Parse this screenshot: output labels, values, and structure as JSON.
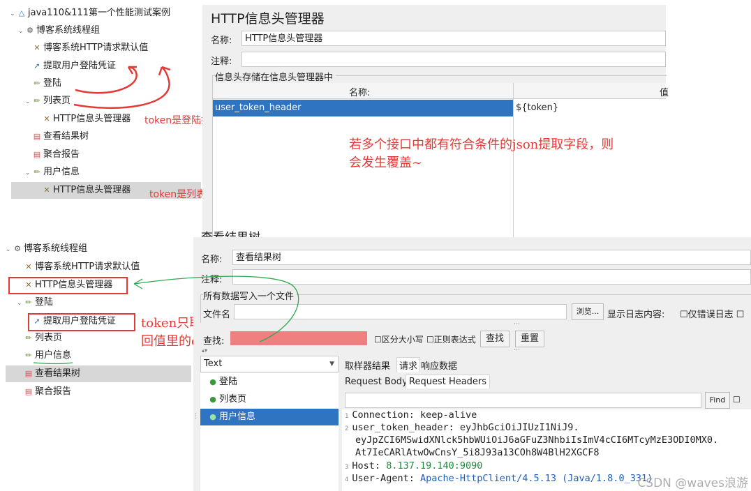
{
  "top_tree": {
    "root": "java110&111第一个性能测试案例",
    "items": [
      {
        "label": "博客系统线程组",
        "icon": "gear-icon"
      },
      {
        "label": "博客系统HTTP请求默认值",
        "icon": "wrench-icon"
      },
      {
        "label": "提取用户登陆凭证",
        "icon": "extract-icon"
      },
      {
        "label": "登陆",
        "icon": "pencil-icon"
      },
      {
        "label": "列表页",
        "icon": "pencil-icon"
      },
      {
        "label": "HTTP信息头管理器",
        "icon": "wrench-icon"
      },
      {
        "label": "查看结果树",
        "icon": "chart-icon"
      },
      {
        "label": "聚合报告",
        "icon": "chart-icon"
      },
      {
        "label": "用户信息",
        "icon": "pencil-icon"
      },
      {
        "label": "HTTP信息头管理器",
        "icon": "wrench-icon"
      }
    ]
  },
  "top_notes": {
    "note1": "token是登陆接口响应数据里data字段",
    "note2": "token是列表页相应数据里的data字段",
    "note3_line1": "若多个接口中都有符合条件的json提取字段，则",
    "note3_line2": "会发生覆盖~"
  },
  "header_manager": {
    "title": "HTTP信息头管理器",
    "name_label": "名称:",
    "name_value": "HTTP信息头管理器",
    "comment_label": "注释:",
    "group_label": "信息头存储在信息头管理器中",
    "col_name": "名称:",
    "col_value": "值",
    "rows": [
      {
        "name": "user_token_header",
        "value": "${token}"
      }
    ]
  },
  "bottom_tree": {
    "items": [
      {
        "label": "博客系统线程组",
        "icon": "gear-icon"
      },
      {
        "label": "博客系统HTTP请求默认值",
        "icon": "wrench-icon"
      },
      {
        "label": "HTTP信息头管理器",
        "icon": "wrench-icon"
      },
      {
        "label": "登陆",
        "icon": "pencil-icon"
      },
      {
        "label": "提取用户登陆凭证",
        "icon": "extract-icon"
      },
      {
        "label": "列表页",
        "icon": "pencil-icon"
      },
      {
        "label": "用户信息",
        "icon": "pencil-icon"
      },
      {
        "label": "查看结果树",
        "icon": "chart-icon"
      },
      {
        "label": "聚合报告",
        "icon": "chart-icon"
      }
    ]
  },
  "bottom_notes": {
    "note1_line1": "token只取登陆接口返",
    "note1_line2": "回值里的data字段"
  },
  "results_tree": {
    "title": "查看结果树",
    "name_label": "名称:",
    "name_value": "查看结果树",
    "comment_label": "注释:",
    "group_label": "所有数据写入一个文件",
    "filename_label": "文件名",
    "browse_button": "浏览...",
    "show_log_label": "显示日志内容:",
    "errors_only_label": "仅错误日志",
    "search_label": "查找:",
    "case_label": "区分大小写",
    "regex_label": "正则表达式",
    "find_button": "查找",
    "reset_button": "重置",
    "renderer": "Text",
    "samples": [
      "登陆",
      "列表页",
      "用户信息"
    ],
    "tabs": [
      "取样器结果",
      "请求",
      "响应数据"
    ],
    "subtabs": [
      "Request Body",
      "Request Headers"
    ],
    "find_label": "Find",
    "headers": [
      {
        "n": "1",
        "key": "Connection:",
        "value": "keep-alive"
      },
      {
        "n": "2",
        "key": "user_token_header:",
        "value": "eyJhbGciOiJIUzI1NiJ9."
      },
      {
        "n": "",
        "key": "",
        "value": "eyJpZCI6MSwidXNlck5hbWUiOiJ6aGFuZ3NhbiIsImV4cCI6MTcyMzE3ODI0MX0."
      },
      {
        "n": "",
        "key": "",
        "value": "At7IeCARlAtwOwCnsY_5i8J93a13COh8W4BlH2XGCF8"
      },
      {
        "n": "3",
        "key": "Host:",
        "value": "8.137.19.140:9090"
      },
      {
        "n": "4",
        "key": "User-Agent:",
        "value": "Apache-HttpClient/4.5.13 (Java/1.8.0_331)"
      }
    ],
    "watermark": "CSDN @waves浪游"
  }
}
